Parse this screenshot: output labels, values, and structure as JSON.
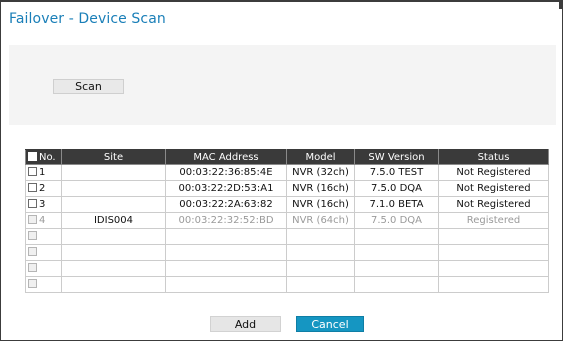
{
  "dialog": {
    "title": "Failover - Device Scan"
  },
  "scan": {
    "button_label": "Scan"
  },
  "table": {
    "columns": [
      "No.",
      "Site",
      "MAC Address",
      "Model",
      "SW Version",
      "Status"
    ],
    "rows": [
      {
        "no": "1",
        "site": "",
        "mac": "00:03:22:36:85:4E",
        "model": "NVR (32ch)",
        "sw": "7.5.0 TEST",
        "status": "Not Registered"
      },
      {
        "no": "2",
        "site": "",
        "mac": "00:03:22:2D:53:A1",
        "model": "NVR (16ch)",
        "sw": "7.5.0 DQA",
        "status": "Not Registered"
      },
      {
        "no": "3",
        "site": "",
        "mac": "00:03:22:2A:63:82",
        "model": "NVR (16ch)",
        "sw": "7.1.0 BETA",
        "status": "Not Registered"
      },
      {
        "no": "4",
        "site": "IDIS004",
        "mac": "00:03:22:32:52:BD",
        "model": "NVR (64ch)",
        "sw": "7.5.0 DQA",
        "status": "Registered"
      }
    ]
  },
  "footer": {
    "add_label": "Add",
    "cancel_label": "Cancel"
  },
  "colors": {
    "title": "#1a7fb8",
    "header_bg": "#3a3a3a",
    "cancel_bg": "#1596c2"
  }
}
